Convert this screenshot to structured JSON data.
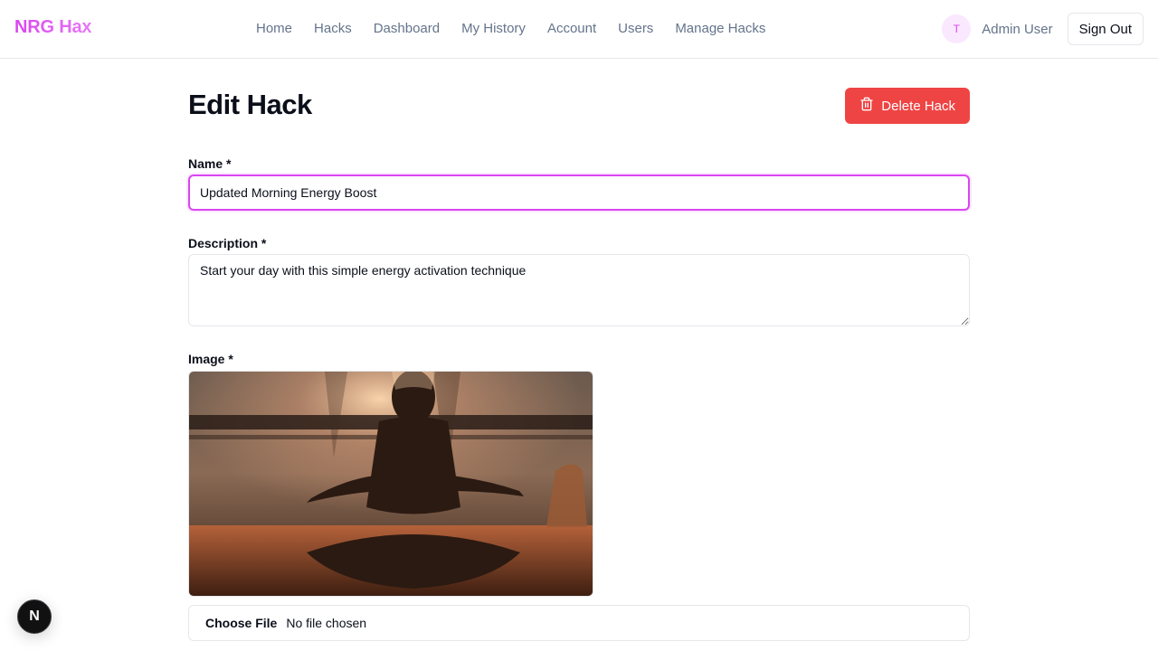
{
  "brand": {
    "name": "NRG Hax"
  },
  "nav": {
    "items": [
      {
        "label": "Home"
      },
      {
        "label": "Hacks"
      },
      {
        "label": "Dashboard"
      },
      {
        "label": "My History"
      },
      {
        "label": "Account"
      },
      {
        "label": "Users"
      },
      {
        "label": "Manage Hacks"
      }
    ]
  },
  "user": {
    "avatar_initial": "T",
    "name": "Admin User",
    "sign_out_label": "Sign Out"
  },
  "page": {
    "title": "Edit Hack",
    "delete_label": "Delete Hack"
  },
  "form": {
    "name_label": "Name *",
    "name_value": "Updated Morning Energy Boost",
    "description_label": "Description *",
    "description_value": "Start your day with this simple energy activation technique",
    "image_label": "Image *",
    "choose_file_label": "Choose File",
    "file_status": "No file chosen"
  },
  "devtools": {
    "badge_letter": "N"
  },
  "colors": {
    "brand": "#d946ef",
    "danger": "#ef4444",
    "muted_text": "#64748b",
    "focus_ring": "#d946ef"
  },
  "icons": {
    "delete": "trash-icon",
    "nextjs": "nextjs-logo-icon"
  }
}
